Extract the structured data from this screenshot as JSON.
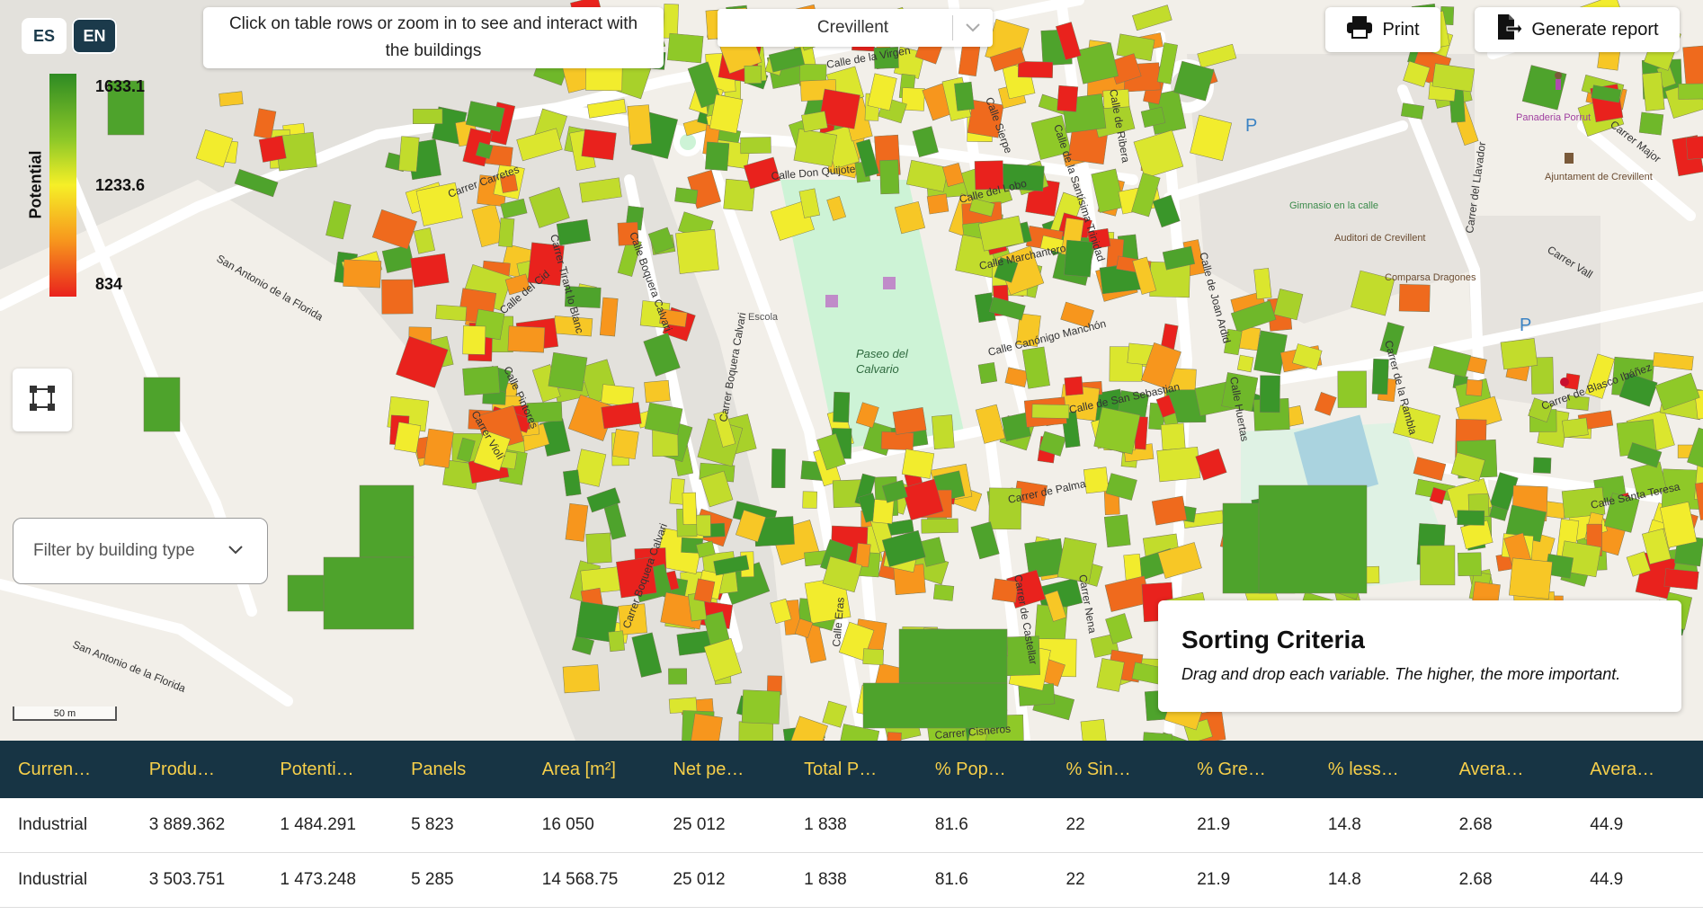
{
  "lang": {
    "es": "ES",
    "en": "EN"
  },
  "legend": {
    "title": "Potential",
    "max": "1633.1",
    "mid": "1233.6",
    "min": "834"
  },
  "hint": "Click on table rows or zoom in to see and interact with the buildings",
  "city_select": {
    "value": "Crevillent"
  },
  "toolbar": {
    "print": "Print",
    "report": "Generate report"
  },
  "filter": {
    "placeholder": "Filter by building type"
  },
  "scale": "50 m",
  "sorting": {
    "title": "Sorting Criteria",
    "subtitle": "Drag and drop each variable. The higher, the more important."
  },
  "map_labels": {
    "paseo": "Paseo del",
    "calvario": "Calvario",
    "streets": [
      "Calle de la Virgen",
      "Calle Don Quijote",
      "Carrer Carretes",
      "San Antonio de la Florida",
      "Calle del Cid",
      "Carrer Tirant lo Blanc",
      "Calle Boquera Calvari",
      "Carrer Boquera Calvari",
      "Calle Marchantero",
      "Calle Canónigo Manchón",
      "Calle de San Sebastian",
      "Carrer de Palma",
      "Calle Eras",
      "Carrer de Castellar",
      "Carrer Nena",
      "Calle Huertas",
      "Calle de Joan Ardid",
      "Carrer de la Rambla",
      "Carrer del Llavador",
      "Carrer Major",
      "Carrer Vall",
      "Carrer de Blasco Ibáñez",
      "Calle Santa Teresa",
      "Carrer Cisneros",
      "Calle del Lobo",
      "Calle Sierpe",
      "Calle de la Santísima Trinidad",
      "Calle de Ribera",
      "Carrer Violí",
      "Calle Pintores"
    ],
    "poi": [
      "Ajuntament de Crevillent",
      "Panaderia Porrut",
      "Gimnasio en la calle",
      "Auditori de Crevillent",
      "Comparsa Dragones",
      "Escola"
    ]
  },
  "table": {
    "headers": [
      "Curren…",
      "Produ…",
      "Potenti…",
      "Panels",
      "Area [m²]",
      "Net pe…",
      "Total P…",
      "% Pop…",
      "% Sin…",
      "% Gre…",
      "% less…",
      "Avera…",
      "Avera…"
    ],
    "rows": [
      [
        "Industrial",
        "3 889.362",
        "1 484.291",
        "5 823",
        "16 050",
        "25 012",
        "1 838",
        "81.6",
        "22",
        "21.9",
        "14.8",
        "2.68",
        "44.9"
      ],
      [
        "Industrial",
        "3 503.751",
        "1 473.248",
        "5 285",
        "14 568.75",
        "25 012",
        "1 838",
        "81.6",
        "22",
        "21.9",
        "14.8",
        "2.68",
        "44.9"
      ]
    ]
  },
  "colors": {
    "header_bg": "#173444",
    "header_text": "#f6cf4a",
    "lang_active": "#1b3a4b"
  }
}
